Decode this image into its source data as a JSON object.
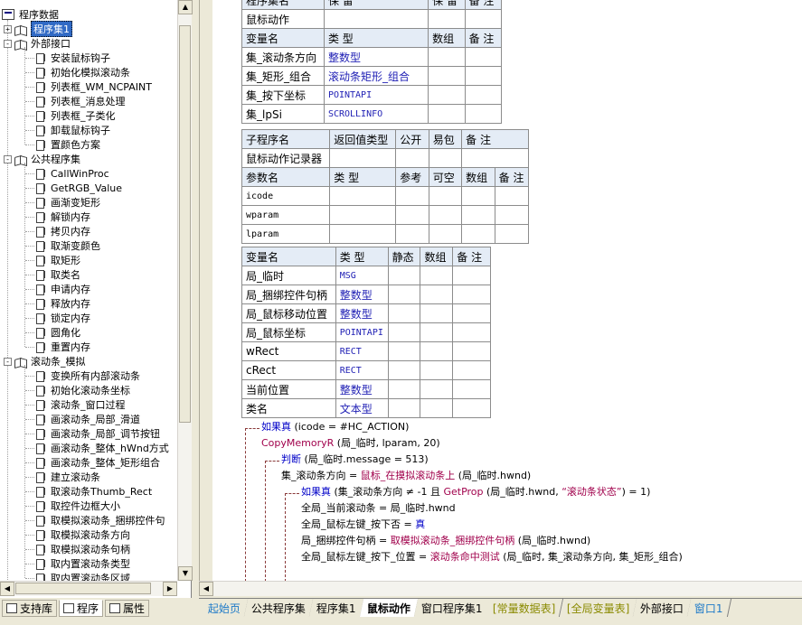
{
  "tree": {
    "root_label": "程序数据",
    "groups": [
      {
        "label": "程序集1",
        "expander": "+",
        "selected": true
      },
      {
        "label": "外部接口",
        "expander": "-",
        "items": [
          "安装鼠标钩子",
          "初始化模拟滚动条",
          "列表框_WM_NCPAINT",
          "列表框_消息处理",
          "列表框_子类化",
          "卸载鼠标钩子",
          "置颜色方案"
        ]
      },
      {
        "label": "公共程序集",
        "expander": "-",
        "items": [
          "CallWinProc",
          "GetRGB_Value",
          "画渐变矩形",
          "解锁内存",
          "拷贝内存",
          "取渐变颜色",
          "取矩形",
          "取类名",
          "申请内存",
          "释放内存",
          "锁定内存",
          "圆角化",
          "重置内存"
        ]
      },
      {
        "label": "滚动条_模拟",
        "expander": "-",
        "items": [
          "变换所有内部滚动条",
          "初始化滚动条坐标",
          "滚动条_窗口过程",
          "画滚动条_局部_滑道",
          "画滚动条_局部_调节按钮",
          "画滚动条_整体_hWnd方式",
          "画滚动条_整体_矩形组合",
          "建立滚动条",
          "取滚动条Thumb_Rect",
          "取控件边框大小",
          "取模拟滚动条_捆绑控件句",
          "取模拟滚动条方向",
          "取模拟滚动条句柄",
          "取内置滚动条类型",
          "取内置滚动条区域"
        ]
      }
    ]
  },
  "left_tabs": [
    {
      "label": "支持库",
      "icon": "book-icon"
    },
    {
      "label": "程序",
      "icon": "program-icon"
    },
    {
      "label": "属性",
      "icon": "property-icon"
    }
  ],
  "table1": {
    "top_row": [
      "程序集名",
      "保 留",
      "保 留",
      "备 注"
    ],
    "name_row": [
      "鼠标动作",
      "",
      "",
      ""
    ],
    "header": [
      "变量名",
      "类 型",
      "数组",
      "备 注"
    ],
    "rows": [
      [
        "集_滚动条方向",
        "整数型",
        "",
        ""
      ],
      [
        "集_矩形_组合",
        "滚动条矩形_组合",
        "",
        ""
      ],
      [
        "集_按下坐标",
        "POINTAPI",
        "",
        ""
      ],
      [
        "集_lpSi",
        "SCROLLINFO",
        "",
        ""
      ]
    ]
  },
  "table2": {
    "header": [
      "子程序名",
      "返回值类型",
      "公开",
      "易包",
      "备 注"
    ],
    "name_row": [
      "鼠标动作记录器",
      "",
      "",
      "",
      ""
    ],
    "param_header": [
      "参数名",
      "类 型",
      "参考",
      "可空",
      "数组",
      "备 注"
    ],
    "params": [
      [
        "icode",
        "",
        "",
        "",
        "",
        ""
      ],
      [
        "wparam",
        "",
        "",
        "",
        "",
        ""
      ],
      [
        "lparam",
        "",
        "",
        "",
        "",
        ""
      ]
    ]
  },
  "table3": {
    "header": [
      "变量名",
      "类 型",
      "静态",
      "数组",
      "备 注"
    ],
    "rows": [
      [
        "局_临时",
        "MSG",
        "",
        "",
        ""
      ],
      [
        "局_捆绑控件句柄",
        "整数型",
        "",
        "",
        ""
      ],
      [
        "局_鼠标移动位置",
        "整数型",
        "",
        "",
        ""
      ],
      [
        "局_鼠标坐标",
        "POINTAPI",
        "",
        "",
        ""
      ],
      [
        "wRect",
        "RECT",
        "",
        "",
        ""
      ],
      [
        "cRect",
        "RECT",
        "",
        "",
        ""
      ],
      [
        "当前位置",
        "整数型",
        "",
        "",
        ""
      ],
      [
        "类名",
        "文本型",
        "",
        "",
        ""
      ]
    ]
  },
  "code": {
    "line1_kw": "如果真",
    "line1_rest": " (icode = #HC_ACTION)",
    "line2_fn": "CopyMemoryR",
    "line2_rest": " (局_临时, lparam, 20)",
    "line3_kw": "判断",
    "line3_rest": " (局_临时.message = 513)",
    "line4_a": "集_滚动条方向 = ",
    "line4_fn": "鼠标_在摸拟滚动条上",
    "line4_rest": " (局_临时.hwnd)",
    "line5_kw": "如果真",
    "line5_mid": " (集_滚动条方向 ≠ -1 且 ",
    "line5_fn": "GetProp",
    "line5_rest": " (局_临时.hwnd, ",
    "line5_str": "“滚动条状态”",
    "line5_end": ") = 1)",
    "line6": "全局_当前滚动条 = 局_临时.hwnd",
    "line7_a": "全局_鼠标左键_按下否 = ",
    "line7_kw": "真",
    "line8_a": "局_捆绑控件句柄 = ",
    "line8_fn": "取模拟滚动条_捆绑控件句柄",
    "line8_rest": " (局_临时.hwnd)",
    "line9_a": "全局_鼠标左键_按下_位置 = ",
    "line9_fn": "滚动条命中测试",
    "line9_rest": " (局_临时, 集_滚动条方向, 集_矩形_组合)"
  },
  "bottom_tabs": [
    {
      "label": "起始页",
      "style": "first"
    },
    {
      "label": "公共程序集",
      "style": "normal"
    },
    {
      "label": "程序集1",
      "style": "normal"
    },
    {
      "label": "鼠标动作",
      "style": "active"
    },
    {
      "label": "窗口程序集1",
      "style": "normal"
    },
    {
      "label": "[常量数据表]",
      "style": "olive"
    },
    {
      "label": "[全局变量表]",
      "style": "olive"
    },
    {
      "label": "外部接口",
      "style": "normal"
    },
    {
      "label": "窗口1",
      "style": "link"
    }
  ],
  "colors": {
    "keyword": "#0000c8",
    "function": "#a0004b",
    "type_blue": "#1e1eb4",
    "header_bg": "#e4ecf6",
    "selection": "#316ac5"
  }
}
